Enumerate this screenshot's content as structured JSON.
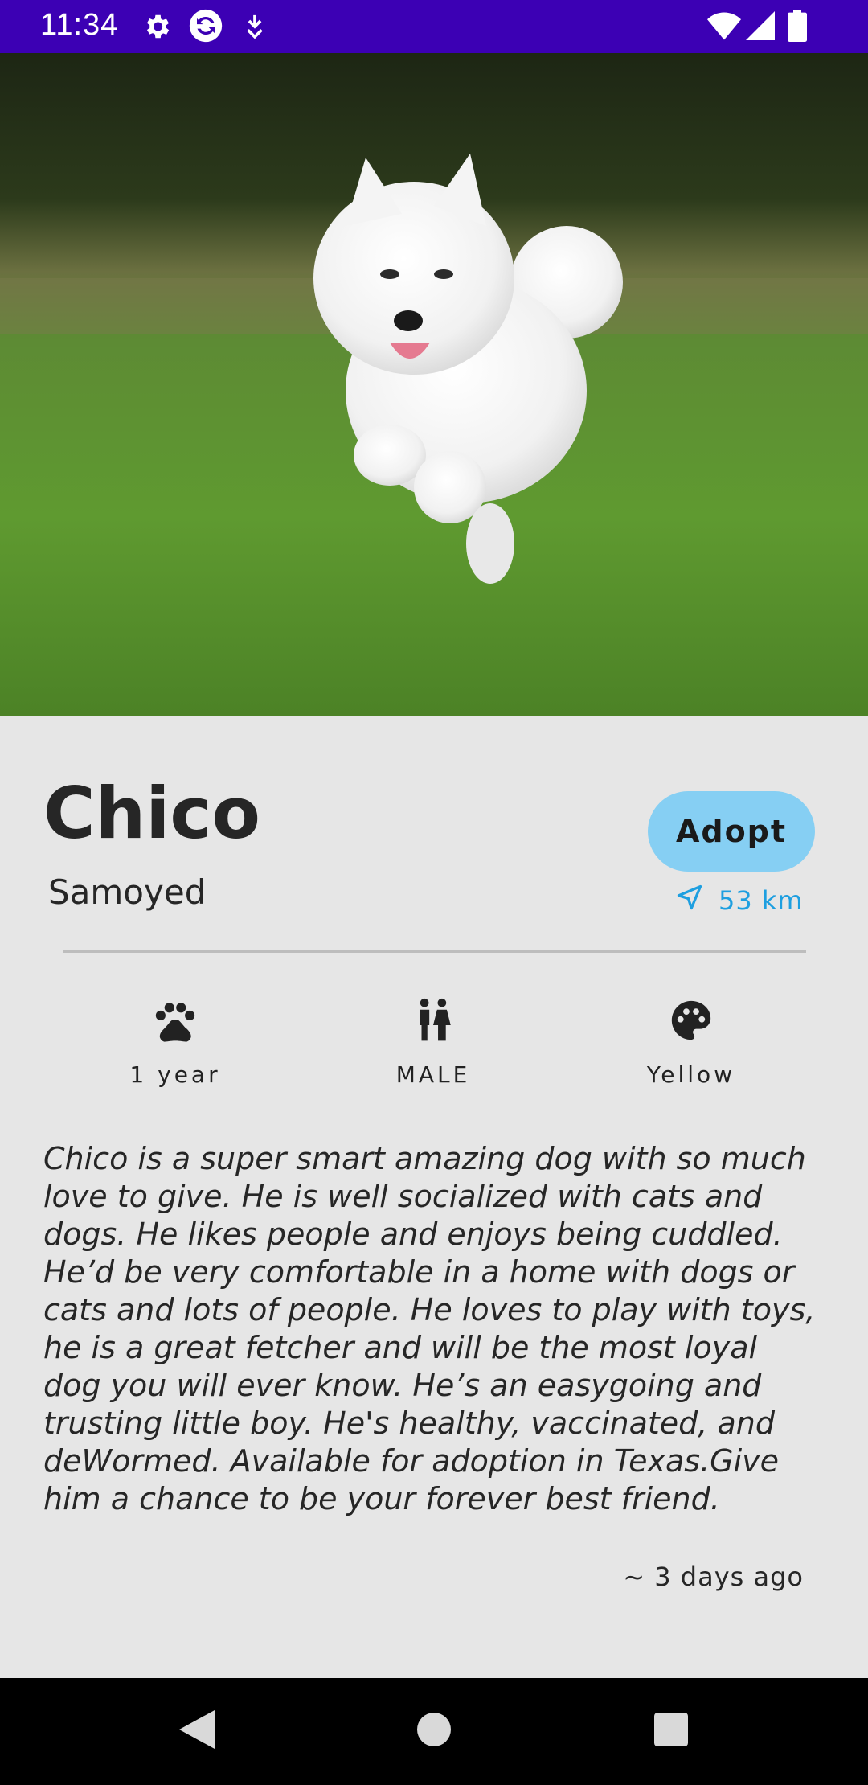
{
  "status_bar": {
    "time": "11:34",
    "icons": [
      "gear-icon",
      "sync-icon",
      "download-icon",
      "wifi-icon",
      "signal-icon",
      "battery-icon"
    ]
  },
  "hero": {
    "image": "photo-of-white-samoyed-running-on-grass"
  },
  "pet": {
    "name": "Chico",
    "breed": "Samoyed",
    "adopt_label": "Adopt",
    "distance": "53 km",
    "age": "1 year",
    "gender": "MALE",
    "color": "Yellow",
    "description": "Chico is a super smart amazing dog with so much love to give. He is well socialized with cats and dogs. He likes people and enjoys being cuddled. He’d be very comfortable in a home with dogs or cats and lots of people. He loves to play with toys, he is a great fetcher and will be the most loyal dog you will ever know. He’s an easygoing and trusting little boy. He's healthy, vaccinated, and deWormed. Available for adoption in Texas.Give him a chance to be your forever best friend.",
    "posted": "~ 3 days ago"
  },
  "nav_bar": {
    "buttons": [
      "back-icon",
      "home-icon",
      "recents-icon"
    ]
  },
  "colors": {
    "status_bar": "#3c00b4",
    "adopt_button": "#86cff3",
    "distance_text": "#1e9fe0",
    "background": "#e6e6e6"
  }
}
